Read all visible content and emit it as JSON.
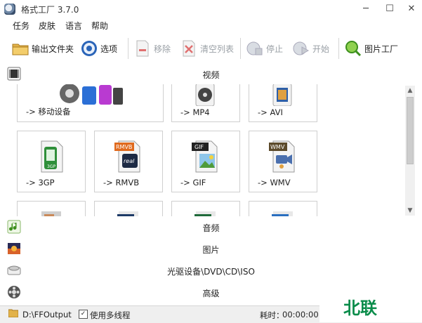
{
  "window": {
    "title": "格式工厂 3.7.0",
    "minimize": "─",
    "maximize": "☐",
    "close": "✕"
  },
  "menu": [
    "任务",
    "皮肤",
    "语言",
    "帮助"
  ],
  "toolbar": {
    "output_folder": "输出文件夹",
    "options": "选项",
    "remove": "移除",
    "clear_list": "清空列表",
    "stop": "停止",
    "start": "开始",
    "picture_factory": "图片工厂"
  },
  "sections": {
    "video": "视频",
    "audio": "音频",
    "picture": "图片",
    "rom": "光驱设备\\DVD\\CD\\ISO",
    "advanced": "高级"
  },
  "tiles": {
    "mobile": "-> 移动设备",
    "mp4": "-> MP4",
    "avi": "-> AVI",
    "gp3": "-> 3GP",
    "rmvb": "-> RMVB",
    "gif": "-> GIF",
    "wmv": "-> WMV"
  },
  "icon_labels": {
    "rmvb": "RMVB",
    "real": "real",
    "gif": "GIF",
    "wmv": "WMV",
    "gp3": "3GP"
  },
  "status": {
    "output_path": "D:\\FFOutput",
    "multithread": "使用多线程",
    "multithread_checked": "✓",
    "elapsed_label": "耗时：",
    "elapsed_value": "00:00:00"
  },
  "watermark": "北联"
}
